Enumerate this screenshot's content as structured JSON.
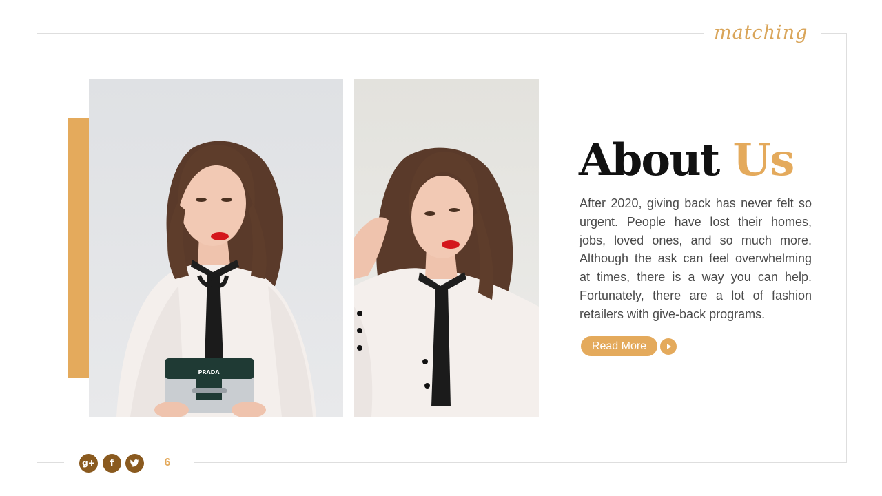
{
  "slide": {
    "logo_text": "matching",
    "heading_main": "About",
    "heading_accent": "Us",
    "body": "After 2020, giving back has never felt so urgent. People have lost their homes, jobs, loved ones, and so much more. Although the ask can feel overwhelming at times, there is a way you can help. Fortunately, there are a lot of fashion retailers with give-back programs.",
    "read_more_label": "Read More",
    "page_number": "6",
    "bag_brand_text": "PRADA"
  },
  "social_icons": [
    "google-plus-icon",
    "facebook-icon",
    "twitter-icon"
  ],
  "colors": {
    "accent": "#e4aa5c",
    "social": "#8a5a1f",
    "frame": "#dedede",
    "heading": "#111111",
    "text": "#4a4a4a"
  }
}
